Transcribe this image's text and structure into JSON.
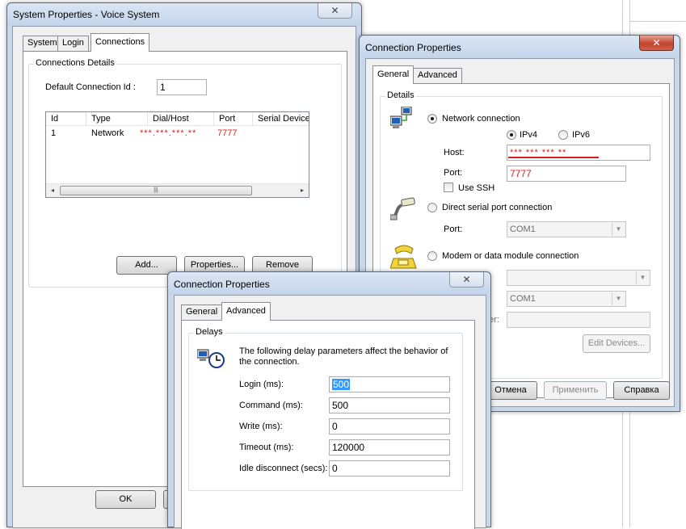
{
  "sys_window": {
    "title": "System Properties - Voice System",
    "tabs": [
      "System",
      "Login",
      "Connections"
    ],
    "group_title": "Connections Details",
    "default_id_label": "Default Connection Id :",
    "default_id_value": "1",
    "columns": [
      "Id",
      "Type",
      "Dial/Host",
      "Port",
      "Serial Device"
    ],
    "row": {
      "id": "1",
      "type": "Network",
      "host": "***.***.***.**",
      "port": "7777"
    },
    "add_label": "Add...",
    "properties_label": "Properties...",
    "remove_label": "Remove",
    "ok_label": "OK"
  },
  "conn_general": {
    "title": "Connection Properties",
    "tabs": [
      "General",
      "Advanced"
    ],
    "group_title": "Details",
    "network_label": "Network connection",
    "ipv4_label": "IPv4",
    "ipv6_label": "IPv6",
    "host_label": "Host:",
    "host_value": "*** *** *** **",
    "port_label": "Port:",
    "port_value": "7777",
    "ssh_label": "Use SSH",
    "serial_label": "Direct serial port connection",
    "serial_port_label": "Port:",
    "serial_port_value": "COM1",
    "modem_label": "Modem or data module connection",
    "modem_port_value": "COM1",
    "partial_label": "er:",
    "edit_devices_label": "Edit Devices...",
    "cancel_label": "Отмена",
    "apply_label": "Применить",
    "help_label": "Справка"
  },
  "conn_advanced": {
    "title": "Connection Properties",
    "tabs": [
      "General",
      "Advanced"
    ],
    "group_title": "Delays",
    "description": "The following delay parameters affect the behavior of the connection.",
    "fields": [
      {
        "label": "Login (ms):",
        "value": "500"
      },
      {
        "label": "Command (ms):",
        "value": "500"
      },
      {
        "label": "Write (ms):",
        "value": "0"
      },
      {
        "label": "Timeout (ms):",
        "value": "120000"
      },
      {
        "label": "Idle disconnect (secs):",
        "value": "0"
      }
    ]
  },
  "colors": {
    "accent_red": "#d62020",
    "selection": "#3399ff",
    "close_red": "#c2442e"
  }
}
